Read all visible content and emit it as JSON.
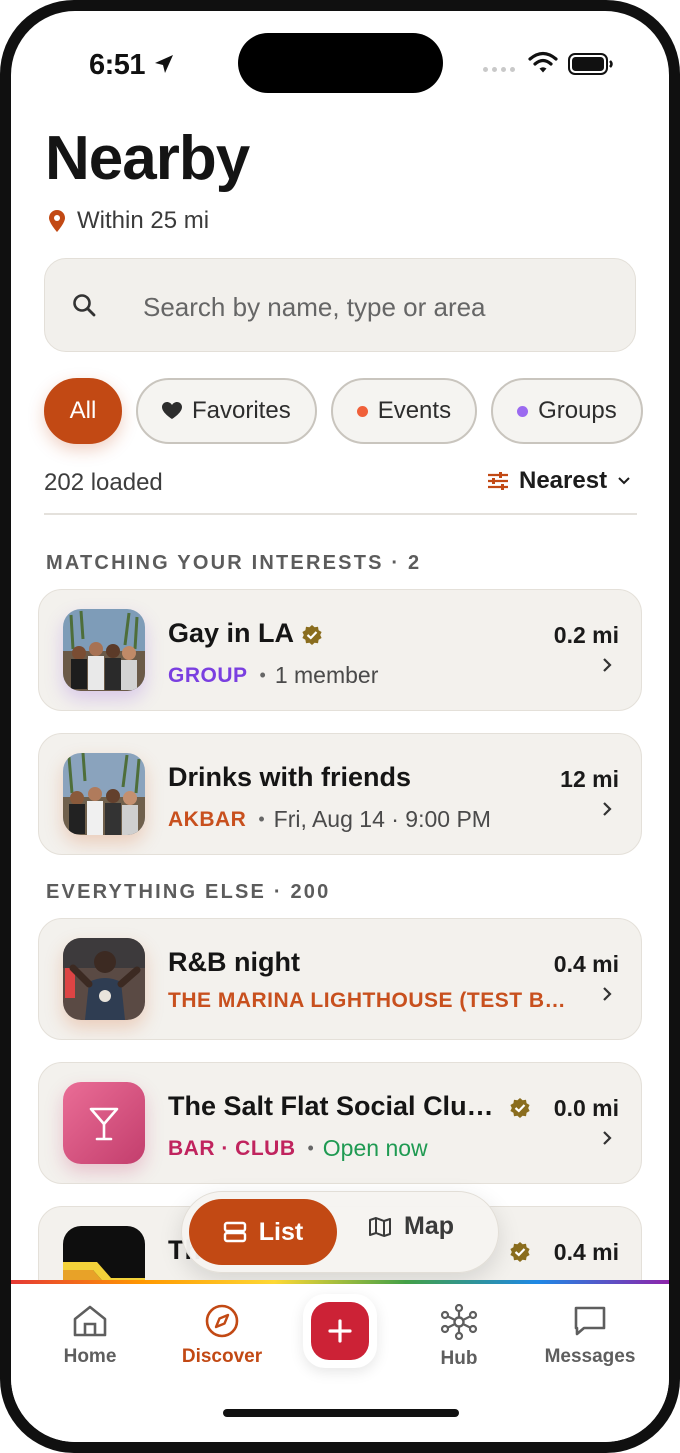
{
  "status_bar": {
    "time": "6:51"
  },
  "header": {
    "title": "Nearby",
    "radius": "Within 25 mi"
  },
  "search": {
    "placeholder": "Search by name, type or area",
    "value": ""
  },
  "filters": [
    {
      "label": "All",
      "active": true
    },
    {
      "label": "Favorites",
      "icon": "heart-icon"
    },
    {
      "label": "Events",
      "dot_color": "#f0603a"
    },
    {
      "label": "Groups",
      "dot_color": "#9b6af0"
    }
  ],
  "list_meta": {
    "loaded": "202 loaded",
    "sort": "Nearest"
  },
  "sections": {
    "matching": "MATCHING YOUR INTERESTS · 2",
    "everything": "EVERYTHING ELSE · 200"
  },
  "items": [
    {
      "title": "Gay in LA",
      "verified": true,
      "tag": "GROUP",
      "tag_color": "#7a3fe0",
      "meta": "1 member",
      "distance": "0.2 mi",
      "thumb": "group-photo"
    },
    {
      "title": "Drinks with friends",
      "verified": false,
      "tag": "AKBAR",
      "tag_color": "#c8501e",
      "meta": "Fri, Aug 14 · 9:00 PM",
      "distance": "12 mi",
      "thumb": "group-photo"
    },
    {
      "title": "R&B night",
      "verified": false,
      "tag": "THE MARINA LIGHTHOUSE (TEST B…",
      "tag_color": "#c8501e",
      "meta": "",
      "distance": "0.4 mi",
      "thumb": "person-photo"
    },
    {
      "title": "The Salt Flat Social Clu…",
      "verified": true,
      "tag": "BAR · CLUB",
      "tag_color": "#c0245e",
      "meta": "Open now",
      "meta_color": "#1f9a52",
      "distance": "0.0 mi",
      "thumb": "cocktail-icon"
    },
    {
      "title": "Th",
      "verified": true,
      "distance": "0.4 mi",
      "thumb": "stripes-art"
    }
  ],
  "view_toggle": {
    "list": "List",
    "map": "Map",
    "active": "list"
  },
  "tabs": [
    {
      "label": "Home",
      "icon": "home-icon"
    },
    {
      "label": "Discover",
      "icon": "compass-icon",
      "active": true
    },
    {
      "label": "Hub",
      "icon": "hub-icon"
    },
    {
      "label": "Messages",
      "icon": "message-icon"
    }
  ],
  "colors": {
    "accent": "#c24914",
    "fab": "#cc2236",
    "card_bg": "#f3f1ed"
  }
}
